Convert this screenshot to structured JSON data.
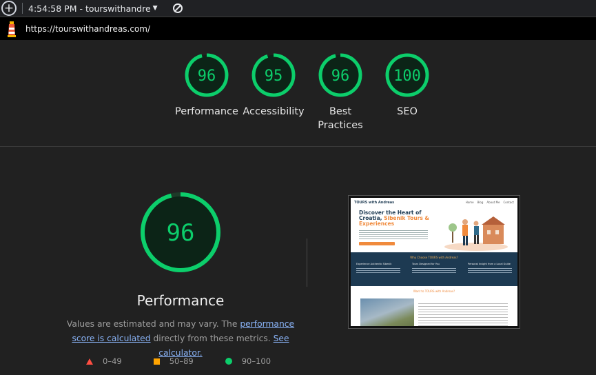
{
  "toolbar": {
    "report_label": "4:54:58 PM - tourswithandre"
  },
  "url": "https://tourswithandreas.com/",
  "categories": [
    {
      "label": "Performance",
      "score": 96
    },
    {
      "label": "Accessibility",
      "score": 95
    },
    {
      "label": "Best Practices",
      "score": 96
    },
    {
      "label": "SEO",
      "score": 100
    }
  ],
  "performance": {
    "title": "Performance",
    "score": 96,
    "desc_prefix": "Values are estimated and may vary. The ",
    "desc_link1": "performance score is calculated",
    "desc_middle": " directly from these metrics. ",
    "desc_link2": "See calculator."
  },
  "legend": {
    "fail": "0–49",
    "average": "50–89",
    "pass": "90–100"
  },
  "colors": {
    "pass": "#0cce6b",
    "average": "#ffa400",
    "fail": "#ff4e42",
    "link": "#8ab4f8"
  },
  "site_preview": {
    "logo": "TOURS with Andreas",
    "nav": [
      "Home",
      "Blog",
      "About Me",
      "Contact"
    ],
    "hero_title_1": "Discover the Heart of Croatia, ",
    "hero_title_highlight": "Sibenik Tours & Experiences",
    "band_title": "Why Choose TOURS with Andreas?",
    "band_cols": [
      "Experience Authentic Sibenik",
      "Tours Designed for You",
      "Personal Insight from a Local Guide"
    ],
    "lower_title": "Want to TOURS with Andreas?"
  }
}
